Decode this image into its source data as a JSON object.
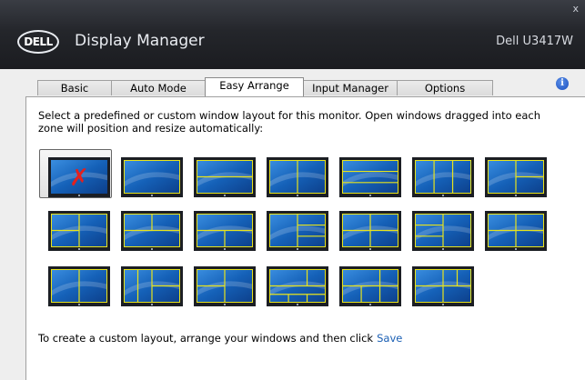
{
  "window": {
    "app_title": "Display Manager",
    "monitor_name": "Dell U3417W",
    "logo_text": "DELL",
    "close_glyph": "x"
  },
  "tabs": [
    {
      "label": "Basic",
      "active": false
    },
    {
      "label": "Auto Mode",
      "active": false
    },
    {
      "label": "Easy Arrange",
      "active": true
    },
    {
      "label": "Input Manager",
      "active": false
    },
    {
      "label": "Options",
      "active": false
    }
  ],
  "info_icon": "info-icon",
  "easy_arrange": {
    "instructions": "Select a predefined or custom window layout for this monitor.  Open windows dragged into each zone will position and resize automatically:",
    "footer_text": "To create a custom layout, arrange your windows and then click",
    "save_label": "Save"
  },
  "layouts": [
    "none",
    "full",
    "top-bottom",
    "two-columns",
    "three-rows",
    "three-columns",
    "right-split",
    "left-split",
    "top-split",
    "bottom-split",
    "bottom-right-split",
    "quad",
    "left-bottom-split",
    "left-right-split",
    "three-columns-uneven",
    "top-bottom-columns",
    "four-columns",
    "bottom-three",
    "bottom-grid",
    "bottom-left-grid"
  ],
  "colors": {
    "zone_line": "#e8e41c",
    "screen_blue": "#1a6fc8",
    "remove_x": "#e3201e"
  }
}
